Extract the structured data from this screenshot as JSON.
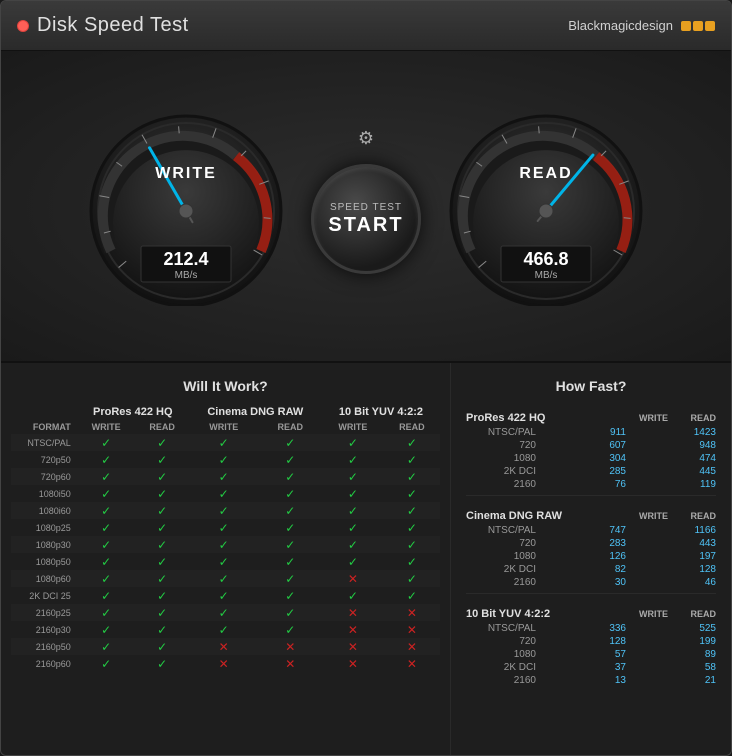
{
  "window": {
    "title": "Disk Speed Test",
    "brand": "Blackmagicdesign"
  },
  "gauges": {
    "write": {
      "label": "WRITE",
      "value": "212.4",
      "unit": "MB/s"
    },
    "read": {
      "label": "READ",
      "value": "466.8",
      "unit": "MB/s"
    }
  },
  "start_button": {
    "sub": "SPEED TEST",
    "main": "START"
  },
  "left_panel": {
    "title": "Will It Work?",
    "headers": {
      "format": "FORMAT",
      "prores": "ProRes 422 HQ",
      "cinema": "Cinema DNG RAW",
      "yuv": "10 Bit YUV 4:2:2"
    },
    "sub_headers": [
      "WRITE",
      "READ",
      "WRITE",
      "READ",
      "WRITE",
      "READ"
    ],
    "rows": [
      {
        "label": "NTSC/PAL",
        "checks": [
          "g",
          "g",
          "g",
          "g",
          "g",
          "g"
        ]
      },
      {
        "label": "720p50",
        "checks": [
          "g",
          "g",
          "g",
          "g",
          "g",
          "g"
        ]
      },
      {
        "label": "720p60",
        "checks": [
          "g",
          "g",
          "g",
          "g",
          "g",
          "g"
        ]
      },
      {
        "label": "1080i50",
        "checks": [
          "g",
          "g",
          "g",
          "g",
          "g",
          "g"
        ]
      },
      {
        "label": "1080i60",
        "checks": [
          "g",
          "g",
          "g",
          "g",
          "g",
          "g"
        ]
      },
      {
        "label": "1080p25",
        "checks": [
          "g",
          "g",
          "g",
          "g",
          "g",
          "g"
        ]
      },
      {
        "label": "1080p30",
        "checks": [
          "g",
          "g",
          "g",
          "g",
          "g",
          "g"
        ]
      },
      {
        "label": "1080p50",
        "checks": [
          "g",
          "g",
          "g",
          "g",
          "g",
          "g"
        ]
      },
      {
        "label": "1080p60",
        "checks": [
          "g",
          "g",
          "g",
          "g",
          "r",
          "g"
        ]
      },
      {
        "label": "2K DCI 25",
        "checks": [
          "g",
          "g",
          "g",
          "g",
          "g",
          "g"
        ]
      },
      {
        "label": "2160p25",
        "checks": [
          "g",
          "g",
          "g",
          "g",
          "r",
          "r"
        ]
      },
      {
        "label": "2160p30",
        "checks": [
          "g",
          "g",
          "g",
          "g",
          "r",
          "r"
        ]
      },
      {
        "label": "2160p50",
        "checks": [
          "g",
          "g",
          "r",
          "r",
          "r",
          "r"
        ]
      },
      {
        "label": "2160p60",
        "checks": [
          "g",
          "g",
          "r",
          "r",
          "r",
          "r"
        ]
      }
    ]
  },
  "right_panel": {
    "title": "How Fast?",
    "sections": [
      {
        "header": "ProRes 422 HQ",
        "col_headers": [
          "WRITE",
          "READ"
        ],
        "rows": [
          {
            "label": "NTSC/PAL",
            "write": "911",
            "read": "1423"
          },
          {
            "label": "720",
            "write": "607",
            "read": "948"
          },
          {
            "label": "1080",
            "write": "304",
            "read": "474"
          },
          {
            "label": "2K DCI",
            "write": "285",
            "read": "445"
          },
          {
            "label": "2160",
            "write": "76",
            "read": "119"
          }
        ]
      },
      {
        "header": "Cinema DNG RAW",
        "col_headers": [
          "WRITE",
          "READ"
        ],
        "rows": [
          {
            "label": "NTSC/PAL",
            "write": "747",
            "read": "1166"
          },
          {
            "label": "720",
            "write": "283",
            "read": "443"
          },
          {
            "label": "1080",
            "write": "126",
            "read": "197"
          },
          {
            "label": "2K DCI",
            "write": "82",
            "read": "128"
          },
          {
            "label": "2160",
            "write": "30",
            "read": "46"
          }
        ]
      },
      {
        "header": "10 Bit YUV 4:2:2",
        "col_headers": [
          "WRITE",
          "READ"
        ],
        "rows": [
          {
            "label": "NTSC/PAL",
            "write": "336",
            "read": "525"
          },
          {
            "label": "720",
            "write": "128",
            "read": "199"
          },
          {
            "label": "1080",
            "write": "57",
            "read": "89"
          },
          {
            "label": "2K DCI",
            "write": "37",
            "read": "58"
          },
          {
            "label": "2160",
            "write": "13",
            "read": "21"
          }
        ]
      }
    ]
  }
}
